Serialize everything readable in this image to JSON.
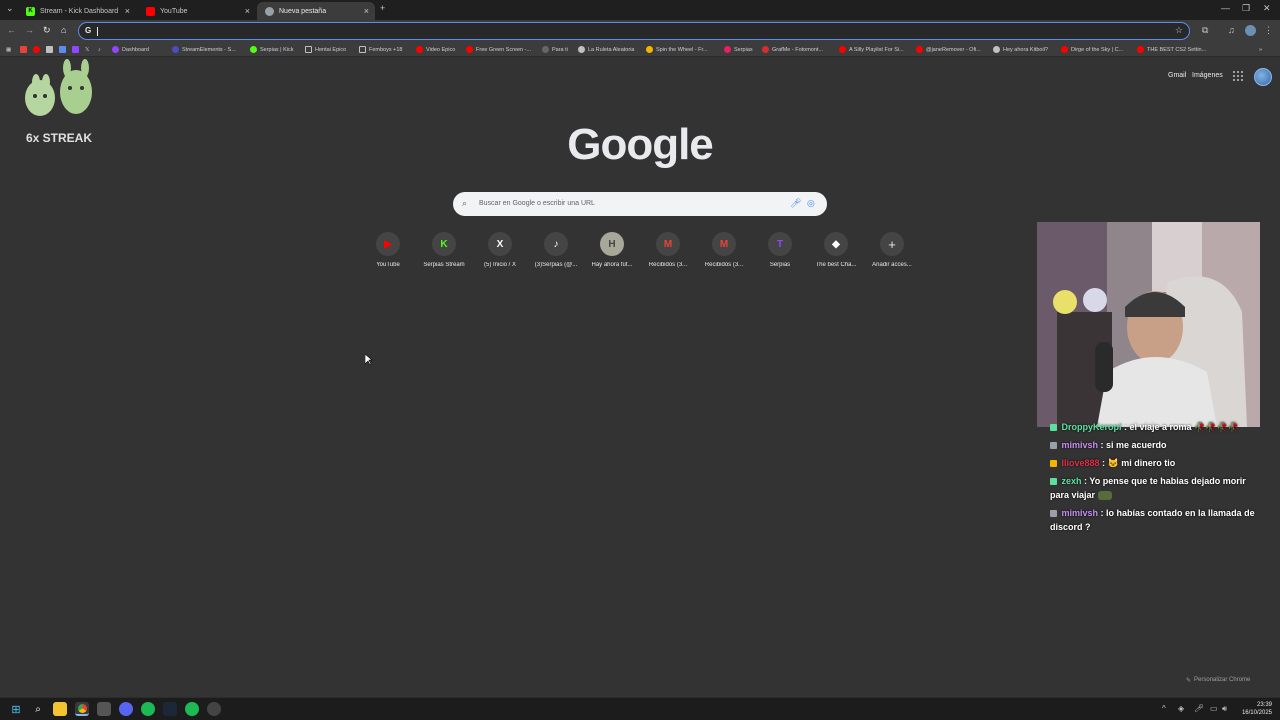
{
  "tabs": [
    {
      "title": "Stream - Kick Dashboard",
      "favicon": "kick-icon",
      "color": "#53fc18",
      "active": false
    },
    {
      "title": "YouTube",
      "favicon": "youtube-icon",
      "color": "#ff0000",
      "active": false
    },
    {
      "title": "Nueva pestaña",
      "favicon": "chrome-icon",
      "color": "#9aa0a6",
      "active": true
    }
  ],
  "omnibox": {
    "value": ""
  },
  "bookmarks": [
    {
      "label": "Dashboard",
      "color": "#9146ff"
    },
    {
      "label": "StreamElements - S...",
      "color": "#4e4cc2"
    },
    {
      "label": "Serpias | Kick",
      "color": "#53fc18"
    },
    {
      "label": "Hentai Epico",
      "color": "#9aa0a6"
    },
    {
      "label": "Femboys +18",
      "color": "#9aa0a6"
    },
    {
      "label": "Video Epico",
      "color": "#ff0000"
    },
    {
      "label": "Free Green Screen -...",
      "color": "#ff0000"
    },
    {
      "label": "Para ti",
      "color": "#e8eaed"
    },
    {
      "label": "La Ruleta Aleatoria",
      "color": "#c0c0c0"
    },
    {
      "label": "Spin the Wheel - Fr...",
      "color": "#f4b400"
    },
    {
      "label": "Serpias",
      "color": "#e91e63"
    },
    {
      "label": "GrafMe - Fotomont...",
      "color": "#d32f2f"
    },
    {
      "label": "A Silly Playlist For Si...",
      "color": "#ff0000"
    },
    {
      "label": "@janeRemover - Ofi...",
      "color": "#ff0000"
    },
    {
      "label": "Hey ahora Kitboil?",
      "color": "#c0c0c0"
    },
    {
      "label": "Dirge of the Sky | C...",
      "color": "#ff0000"
    },
    {
      "label": "THE BEST CS2 Settin...",
      "color": "#ff0000"
    }
  ],
  "header_links": {
    "gmail": "Gmail",
    "images": "Imágenes"
  },
  "logo": "Google",
  "search": {
    "placeholder": "Buscar en Google o escribir una URL"
  },
  "shortcuts": [
    {
      "label": "YouTube",
      "glyph": "▶",
      "color": "#ff0000",
      "icon": "youtube-icon"
    },
    {
      "label": "Serpias Stream",
      "glyph": "K",
      "color": "#53fc18",
      "icon": "kick-icon"
    },
    {
      "label": "(5) Inicio / X",
      "glyph": "X",
      "color": "#ffffff",
      "icon": "x-icon"
    },
    {
      "label": "(3)Serpias (@...",
      "glyph": "♪",
      "color": "#ffffff",
      "icon": "tiktok-icon"
    },
    {
      "label": "Hay ahora fút...",
      "glyph": "H",
      "color": "#b0b0a0",
      "icon": "site-icon"
    },
    {
      "label": "Recibidos (3...",
      "glyph": "M",
      "color": "#ea4335",
      "icon": "gmail-icon"
    },
    {
      "label": "Recibidos (3...",
      "glyph": "M",
      "color": "#ea4335",
      "icon": "gmail-icon"
    },
    {
      "label": "Serpias",
      "glyph": "T",
      "color": "#9146ff",
      "icon": "twitch-icon"
    },
    {
      "label": "The best Cha...",
      "glyph": "◆",
      "color": "#ffffff",
      "icon": "diamond-icon"
    },
    {
      "label": "Añadir acces...",
      "glyph": "+",
      "color": "#e8eaed",
      "icon": "plus-icon"
    }
  ],
  "customize": "Personalizar Chrome",
  "streak": "6x STREAK",
  "chat": [
    {
      "user": "DroppyKeropi",
      "user_color": "#5ce0a0",
      "message": " : el viaje a roma 🥀🥀🥀🥀"
    },
    {
      "user": "mimivsh",
      "user_color": "#c48ef0",
      "message": " : si me acuerdo"
    },
    {
      "user": "lliove888",
      "user_color": "#e0304a",
      "message": " : 🐱 mi dinero tio"
    },
    {
      "user": "zexh",
      "user_color": "#5ce0a0",
      "message": " : Yo pense que te habias dejado morir para viajar"
    },
    {
      "user": "mimivsh",
      "user_color": "#c48ef0",
      "message": " : lo habías contado en la llamada de discord ?"
    }
  ],
  "clock": {
    "time": "23:39",
    "date": "16/10/2025"
  }
}
